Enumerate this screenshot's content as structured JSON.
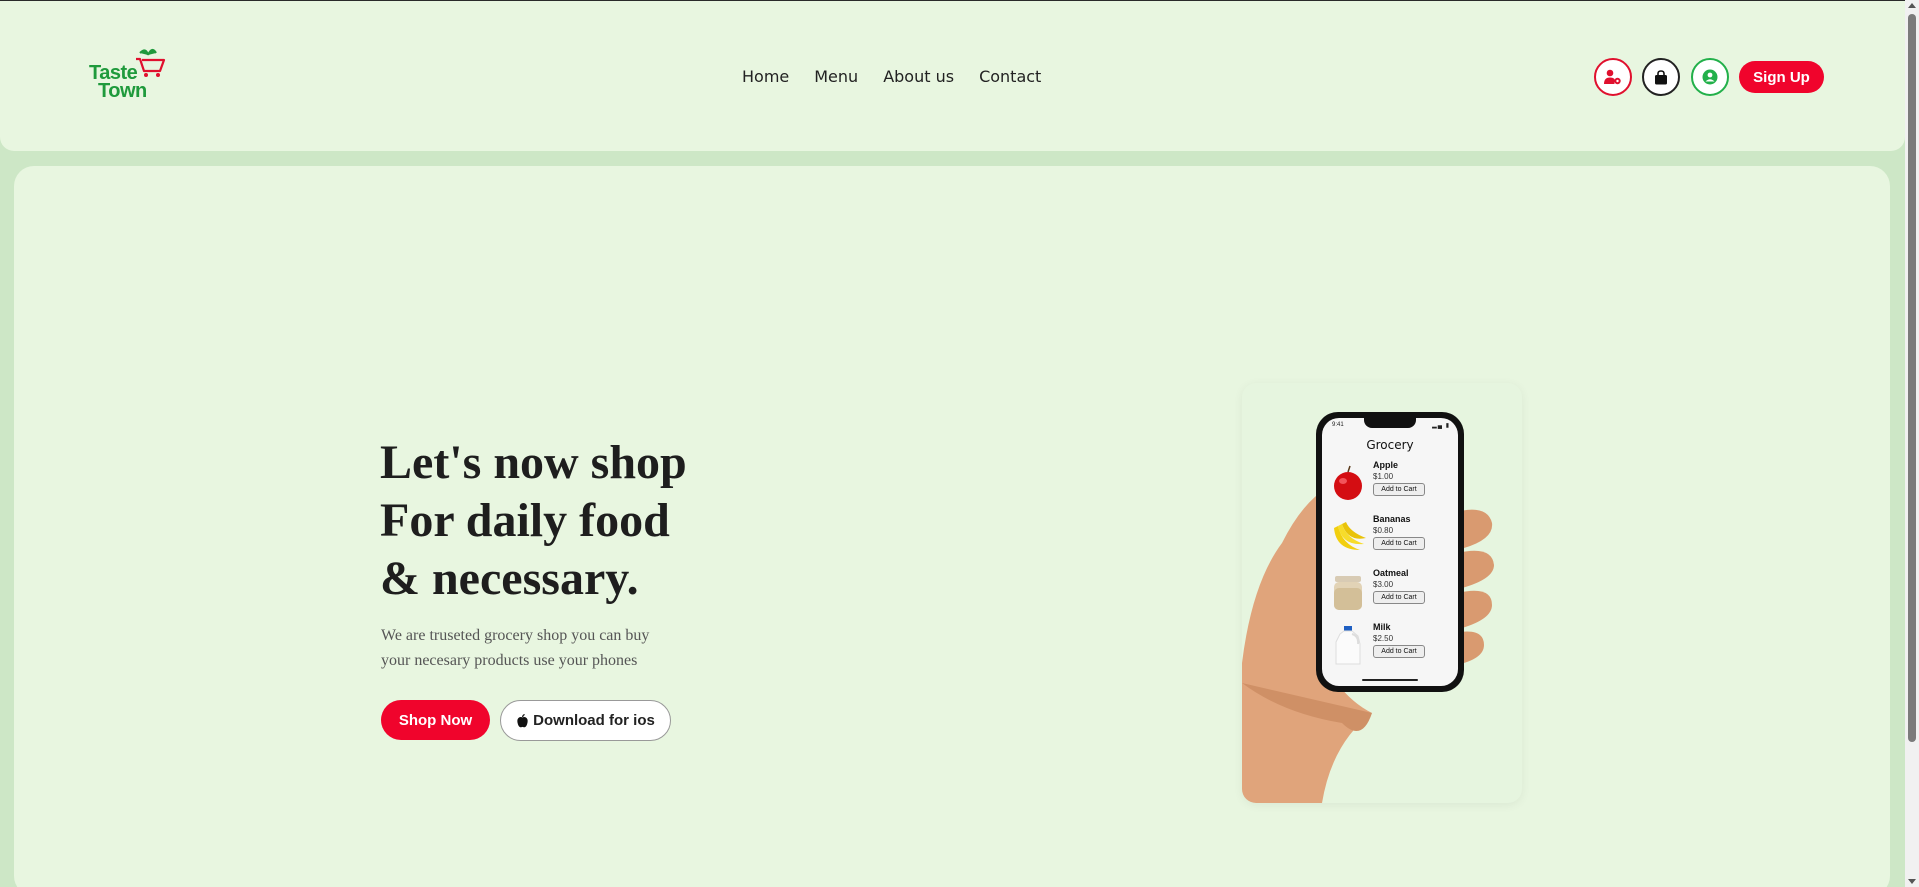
{
  "brand": {
    "line1": "Taste",
    "line2": "Town"
  },
  "nav": {
    "items": [
      "Home",
      "Menu",
      "About us",
      "Contact"
    ]
  },
  "header_actions": {
    "admin_icon": "user-gear-icon",
    "bag_icon": "shopping-bag-icon",
    "profile_icon": "user-circle-icon",
    "signup_label": "Sign Up"
  },
  "hero": {
    "headline": [
      "Let's now shop",
      "For daily food",
      "& necessary."
    ],
    "description": [
      "We are truseted grocery shop you can buy",
      "your necesary products use your phones"
    ],
    "primary_cta": "Shop Now",
    "secondary_cta": "Download for ios",
    "secondary_cta_icon": "apple-icon"
  },
  "phone_screen": {
    "time": "9:41",
    "title": "Grocery",
    "items": [
      {
        "name": "Apple",
        "price": "$1.00",
        "button": "Add to Cart"
      },
      {
        "name": "Bananas",
        "price": "$0.80",
        "button": "Add to Cart"
      },
      {
        "name": "Oatmeal",
        "price": "$3.00",
        "button": "Add to Cart"
      },
      {
        "name": "Milk",
        "price": "$2.50",
        "button": "Add to Cart"
      }
    ]
  },
  "colors": {
    "accent": "#f0042c",
    "brand_green": "#1f9a3c",
    "page_bg": "#cde7c6",
    "card_bg": "#e8f6e0"
  }
}
